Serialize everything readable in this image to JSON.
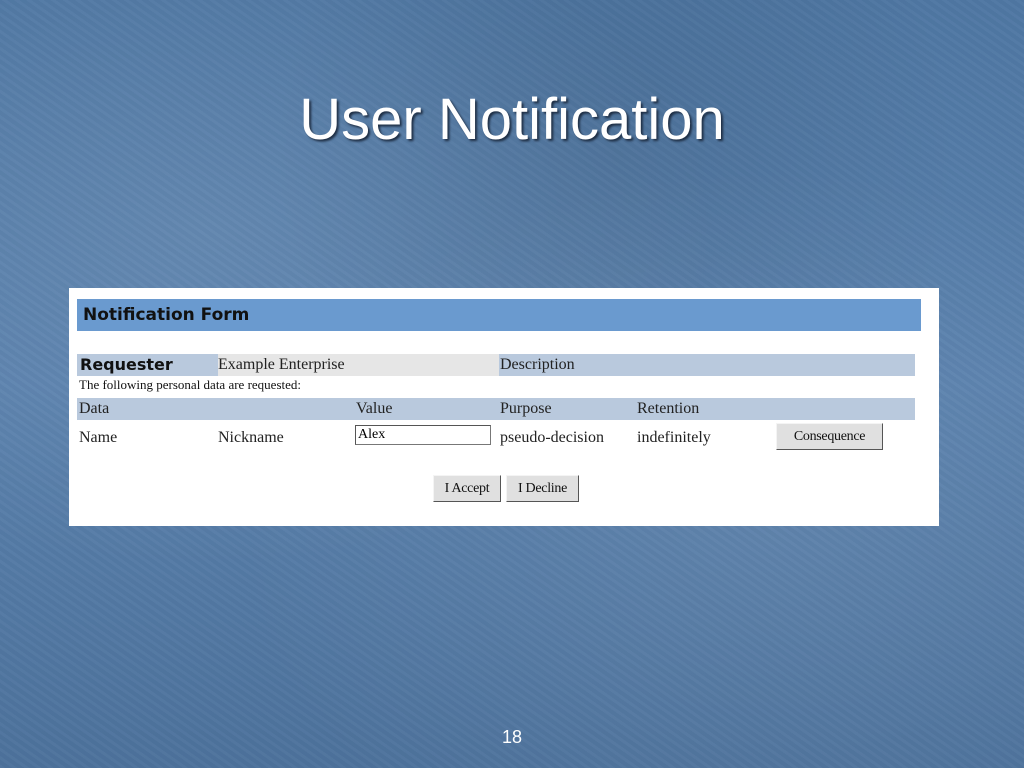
{
  "slide": {
    "title": "User Notification",
    "page_number": "18"
  },
  "form": {
    "title": "Notification Form",
    "requester_label": "Requester",
    "requester_name": "Example Enterprise",
    "description_label": "Description",
    "note": "The following personal data are requested:",
    "columns": [
      "Data",
      "Value",
      "Purpose",
      "Retention"
    ],
    "rows": [
      {
        "data": "Name",
        "field": "Nickname",
        "value": "Alex",
        "purpose": "pseudo-decision",
        "retention": "indefinitely",
        "action_label": "Consequence"
      }
    ],
    "accept_label": "I Accept",
    "decline_label": "I Decline"
  },
  "colors": {
    "background": "#5a81ad",
    "header_bar": "#6a9acf",
    "row_shade": "#b9c9dd"
  }
}
